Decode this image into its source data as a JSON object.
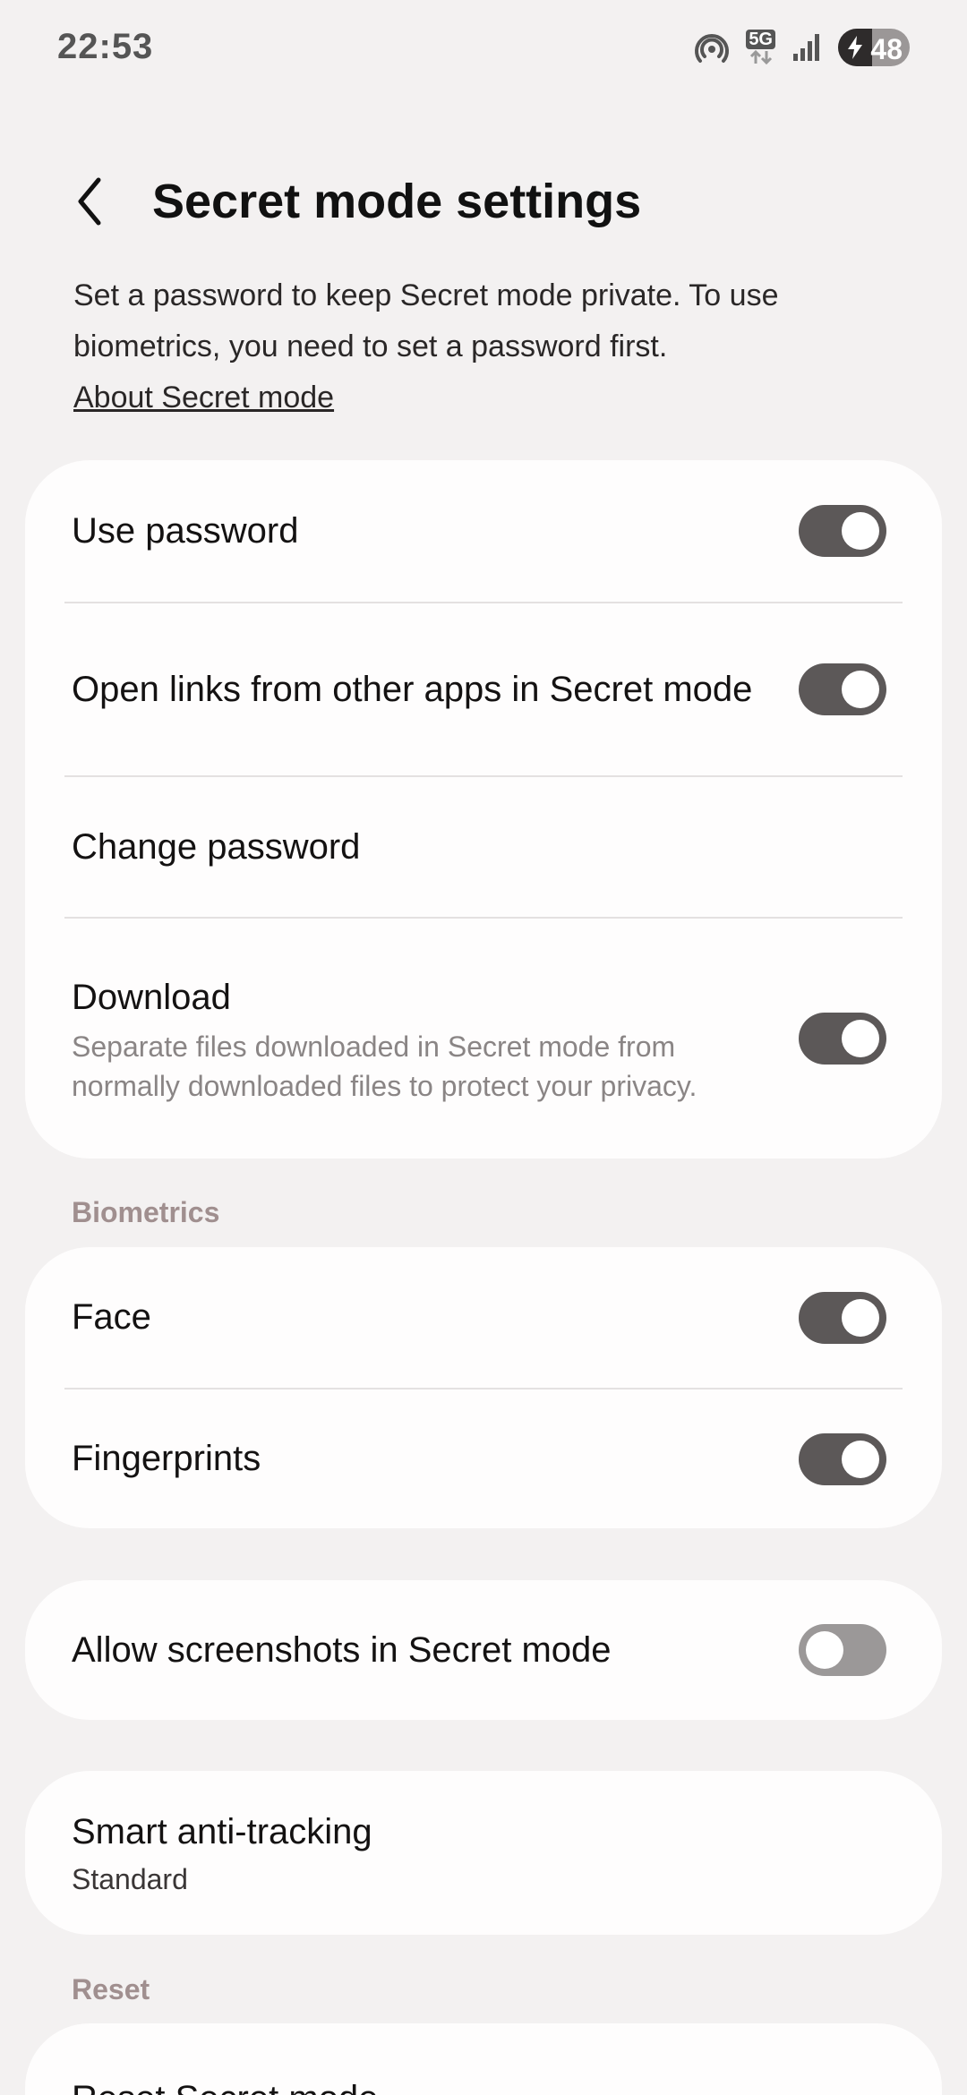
{
  "status": {
    "time": "22:53",
    "network_badge": "5G",
    "battery_level": "48",
    "battery_fraction": 0.48,
    "icons": [
      "hotspot-icon",
      "5g-data-icon",
      "signal-icon",
      "battery-charging-icon"
    ]
  },
  "header": {
    "title": "Secret mode settings",
    "back_icon": "chevron-left-icon"
  },
  "intro": {
    "text": "Set a password to keep Secret mode private. To use biometrics, you need to set a password first.",
    "link": "About Secret mode"
  },
  "group_password": {
    "use_password": {
      "label": "Use password",
      "enabled": true
    },
    "open_links": {
      "label": "Open links from other apps in Secret mode",
      "enabled": true
    },
    "change_password": {
      "label": "Change password"
    },
    "download": {
      "label": "Download",
      "description": "Separate files downloaded in Secret mode from normally downloaded files to protect your privacy.",
      "enabled": true
    }
  },
  "biometrics": {
    "section_label": "Biometrics",
    "face": {
      "label": "Face",
      "enabled": true
    },
    "fingerprints": {
      "label": "Fingerprints",
      "enabled": true
    }
  },
  "screenshots": {
    "label": "Allow screenshots in Secret mode",
    "enabled": false
  },
  "anti_tracking": {
    "label": "Smart anti-tracking",
    "value": "Standard"
  },
  "reset": {
    "section_label": "Reset",
    "reset_label": "Reset Secret mode"
  },
  "colors": {
    "background": "#f3f1f1",
    "card": "#fefdfd",
    "toggle_on": "#5c5858",
    "toggle_off": "#9b9898",
    "section_label": "#a08f8f"
  }
}
